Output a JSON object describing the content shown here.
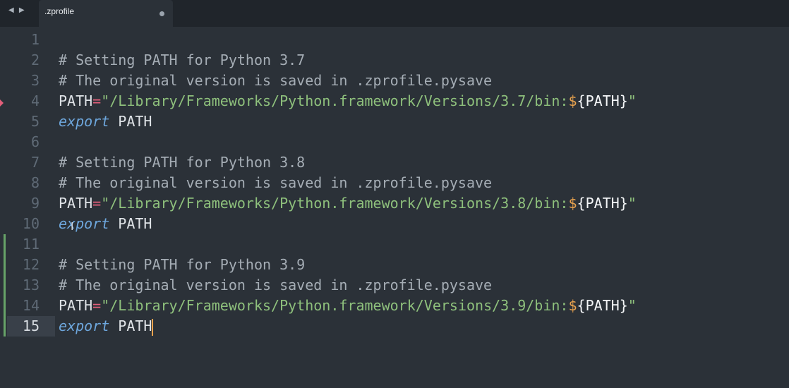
{
  "tab": {
    "title": ".zprofile",
    "nav_glyph": "◀ ▶"
  },
  "lines": [
    {
      "num": "1",
      "parts": []
    },
    {
      "num": "2",
      "parts": [
        {
          "t": "comment",
          "v": "# Setting PATH for Python 3.7"
        }
      ]
    },
    {
      "num": "3",
      "parts": [
        {
          "t": "comment",
          "v": "# The original version is saved in .zprofile.pysave"
        }
      ]
    },
    {
      "num": "4",
      "parts": [
        {
          "t": "var",
          "v": "PATH"
        },
        {
          "t": "eq",
          "v": "="
        },
        {
          "t": "str",
          "v": "\"/Library/Frameworks/Python.framework/Versions/3.7/bin:"
        },
        {
          "t": "dollar",
          "v": "$"
        },
        {
          "t": "brace",
          "v": "{PATH}"
        },
        {
          "t": "str",
          "v": "\""
        }
      ]
    },
    {
      "num": "5",
      "parts": [
        {
          "t": "kw",
          "v": "export"
        },
        {
          "t": "var",
          "v": " PATH"
        }
      ]
    },
    {
      "num": "6",
      "parts": []
    },
    {
      "num": "7",
      "parts": [
        {
          "t": "comment",
          "v": "# Setting PATH for Python 3.8"
        }
      ]
    },
    {
      "num": "8",
      "parts": [
        {
          "t": "comment",
          "v": "# The original version is saved in .zprofile.pysave"
        }
      ]
    },
    {
      "num": "9",
      "parts": [
        {
          "t": "var",
          "v": "PATH"
        },
        {
          "t": "eq",
          "v": "="
        },
        {
          "t": "str",
          "v": "\"/Library/Frameworks/Python.framework/Versions/3.8/bin:"
        },
        {
          "t": "dollar",
          "v": "$"
        },
        {
          "t": "brace",
          "v": "{PATH}"
        },
        {
          "t": "str",
          "v": "\""
        }
      ]
    },
    {
      "num": "10",
      "parts": [
        {
          "t": "kw",
          "v": "export"
        },
        {
          "t": "var",
          "v": " PATH"
        }
      ]
    },
    {
      "num": "11",
      "parts": [],
      "modified": true
    },
    {
      "num": "12",
      "parts": [
        {
          "t": "comment",
          "v": "# Setting PATH for Python 3.9"
        }
      ],
      "modified": true
    },
    {
      "num": "13",
      "parts": [
        {
          "t": "comment",
          "v": "# The original version is saved in .zprofile.pysave"
        }
      ],
      "modified": true
    },
    {
      "num": "14",
      "parts": [
        {
          "t": "var",
          "v": "PATH"
        },
        {
          "t": "eq",
          "v": "="
        },
        {
          "t": "str",
          "v": "\"/Library/Frameworks/Python.framework/Versions/3.9/bin:"
        },
        {
          "t": "dollar",
          "v": "$"
        },
        {
          "t": "brace",
          "v": "{PATH}"
        },
        {
          "t": "str",
          "v": "\""
        }
      ],
      "modified": true
    },
    {
      "num": "15",
      "parts": [
        {
          "t": "kw",
          "v": "export"
        },
        {
          "t": "var",
          "v": " PATH"
        }
      ],
      "modified": true,
      "active": true
    }
  ],
  "colors": {
    "background": "#2b3138",
    "comment": "#a5adb5",
    "string": "#8ec07c",
    "keyword": "#6ea7dd",
    "operator": "#e35f7a",
    "cursor": "#e8a24e",
    "gutter_modified": "#67a368"
  },
  "icons": {
    "dirty_indicator": "unsaved-dot-icon",
    "mouse_pointer": "ibeam-cursor-icon"
  }
}
